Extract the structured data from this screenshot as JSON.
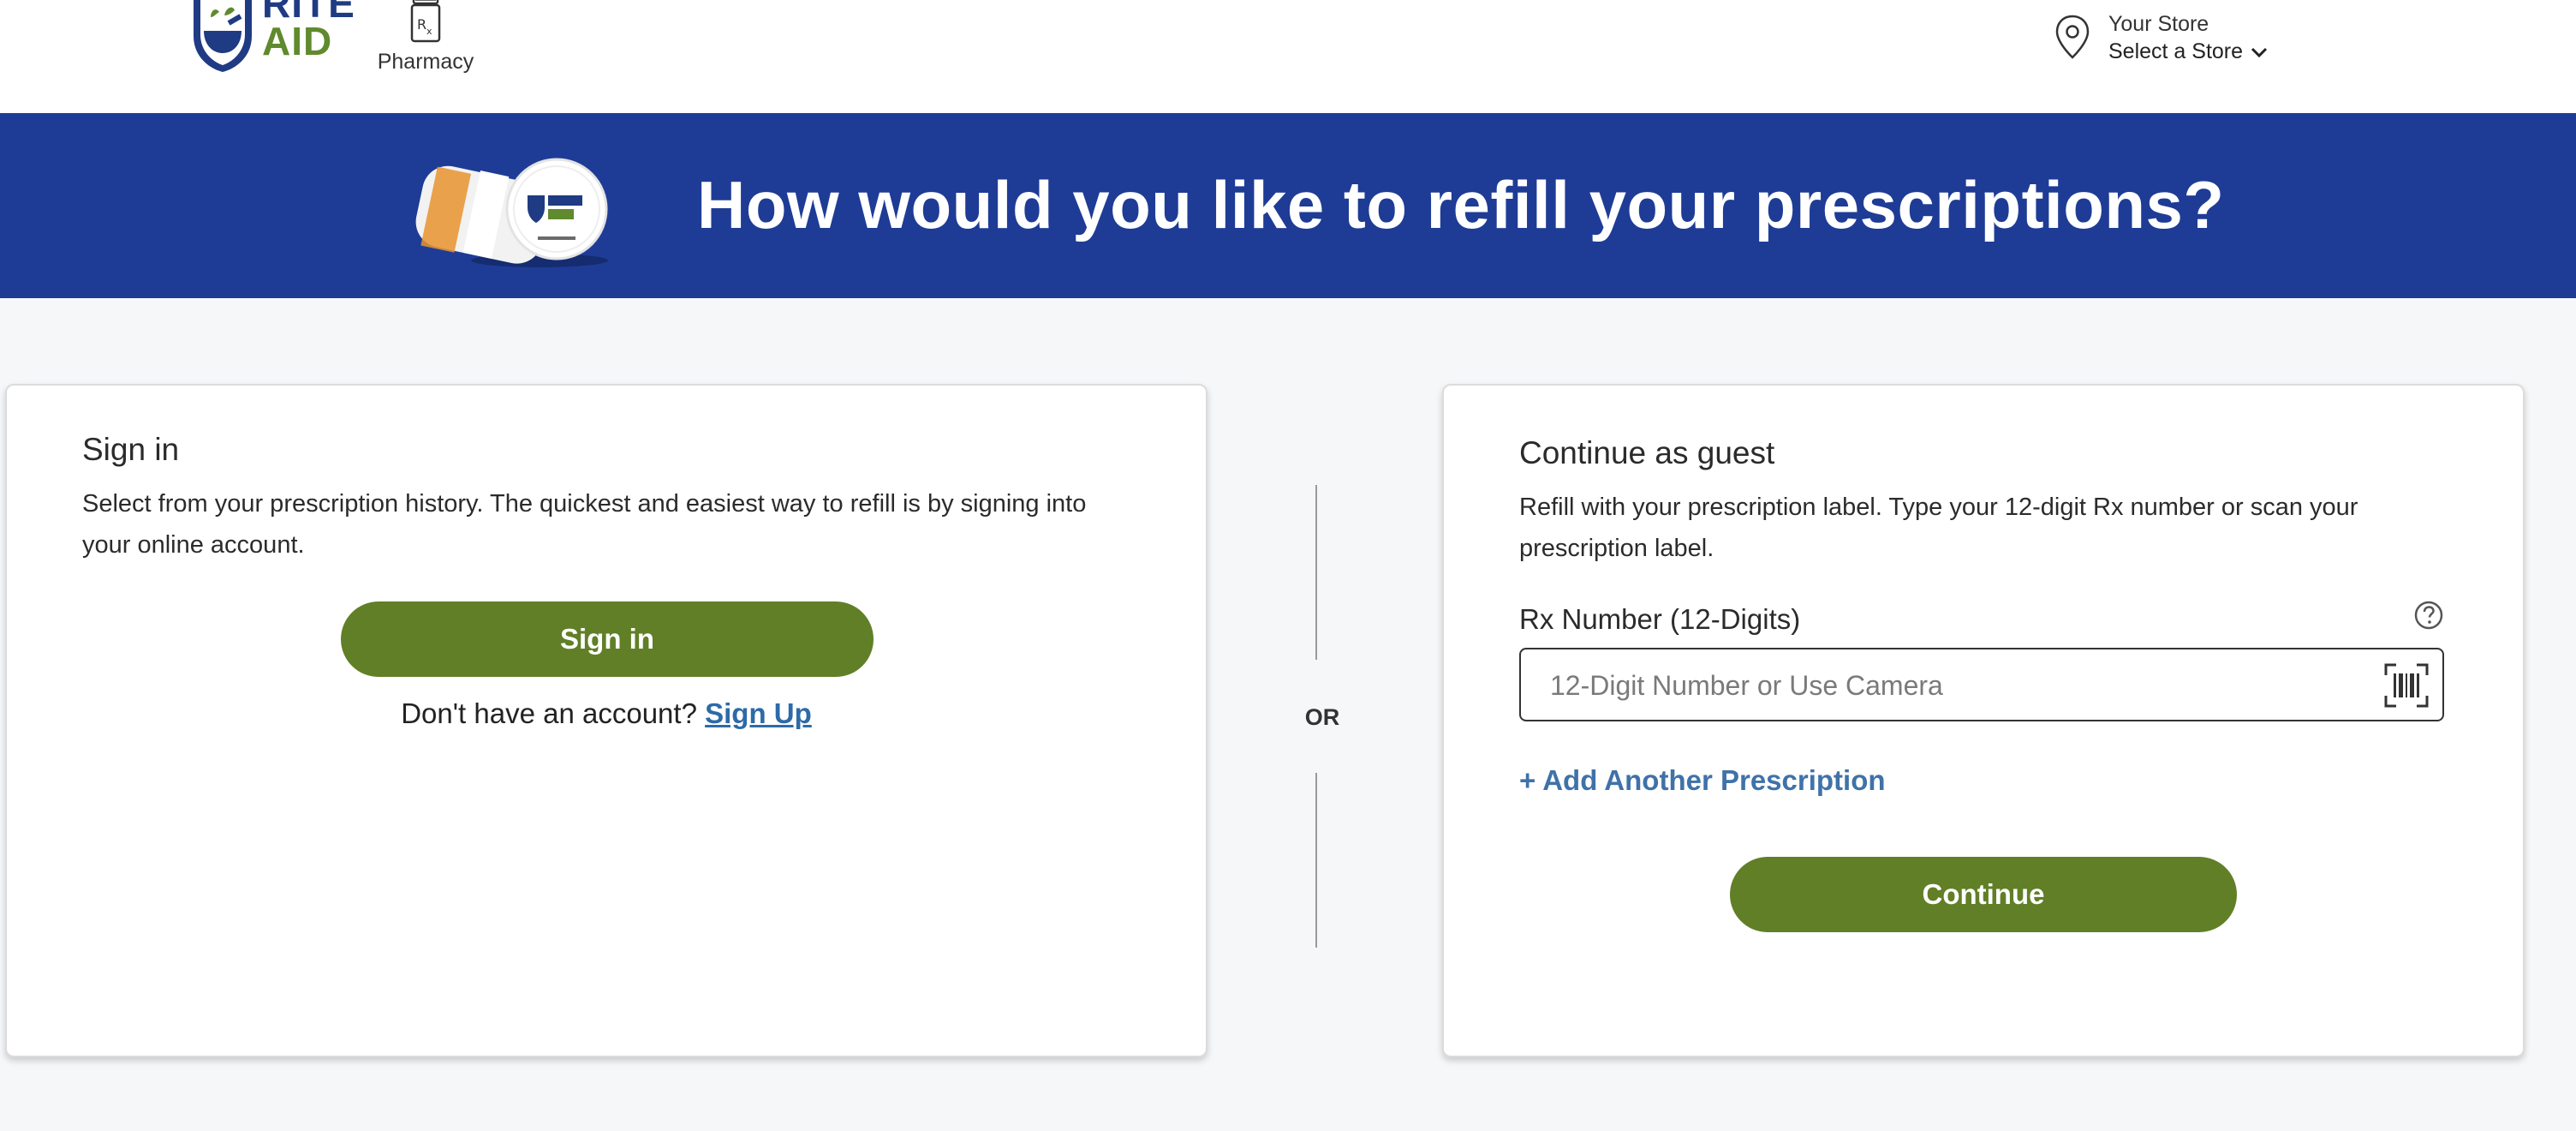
{
  "header": {
    "logo": {
      "line1": "RITE",
      "line2": "AID"
    },
    "pharmacy_label": "Pharmacy",
    "store": {
      "label": "Your Store",
      "select_label": "Select a Store"
    }
  },
  "banner": {
    "title": "How would you like to refill your prescriptions?"
  },
  "signin_card": {
    "title": "Sign in",
    "description": "Select from your prescription history. The quickest and easiest way to refill is by signing into your online account.",
    "button_label": "Sign in",
    "no_account_text": "Don't have an account?",
    "signup_link": "Sign Up"
  },
  "separator": {
    "label": "OR"
  },
  "guest_card": {
    "title": "Continue as guest",
    "description": "Refill with your prescription label. Type your 12-digit Rx number or scan your prescription label.",
    "rx_label": "Rx Number (12-Digits)",
    "rx_input": {
      "value": "",
      "placeholder": "12-Digit Number or Use Camera"
    },
    "add_prescription": "+ Add Another Prescription",
    "continue_label": "Continue"
  },
  "colors": {
    "brand_blue": "#1e3c96",
    "brand_green": "#617f27",
    "link_blue": "#2d6aa8"
  },
  "icons": [
    "logo-shield-icon",
    "prescription-bottle-icon",
    "location-pin-icon",
    "chevron-down-icon",
    "help-icon",
    "barcode-scan-icon"
  ]
}
